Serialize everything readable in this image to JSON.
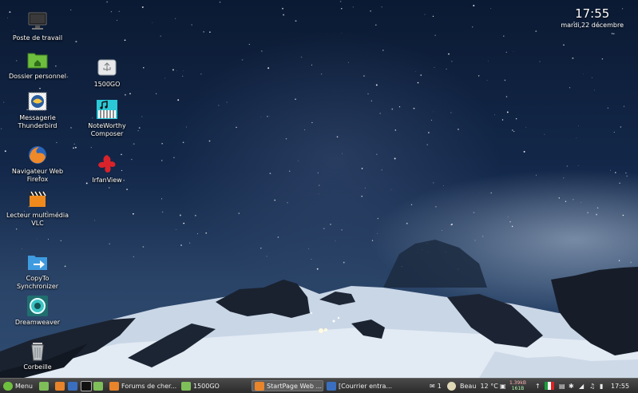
{
  "clock": {
    "time": "17:55",
    "date": "mardi,22 décembre"
  },
  "desktop_icons": [
    {
      "label": "Poste de travail",
      "icon": "computer-icon"
    },
    {
      "label": "Dossier personnel",
      "icon": "home-folder-icon"
    },
    {
      "label": "Messagerie Thunderbird",
      "icon": "thunderbird-icon"
    },
    {
      "label": "Navigateur Web Firefox",
      "icon": "firefox-icon"
    },
    {
      "label": "Lecteur multimédia VLC",
      "icon": "vlc-icon"
    },
    {
      "label": "CopyTo Synchronizer",
      "icon": "sync-folder-icon"
    },
    {
      "label": "Dreamweaver",
      "icon": "dreamweaver-icon"
    },
    {
      "label": "Corbeille",
      "icon": "trash-icon"
    },
    {
      "label": "1500GO",
      "icon": "usb-drive-icon"
    },
    {
      "label": "NoteWorthy Composer",
      "icon": "music-composer-icon"
    },
    {
      "label": "IrfanView",
      "icon": "irfanview-icon"
    }
  ],
  "taskbar": {
    "menu_label": "Menu",
    "windows": [
      {
        "label": "Forums de cher...",
        "icon": "firefox-icon"
      },
      {
        "label": "1500GO",
        "icon": "folder-icon"
      },
      {
        "label": "StartPage Web ...",
        "icon": "firefox-icon"
      },
      {
        "label": "[Courrier entra...",
        "icon": "thunderbird-icon"
      }
    ],
    "notification_count": "1",
    "weather": "Beau  12 °C",
    "net_up": "1.39kB",
    "net_down": "161B",
    "time": "17:55"
  },
  "colors": {
    "accent": "#6fbf3f",
    "taskbar": "#2b2b2b"
  }
}
